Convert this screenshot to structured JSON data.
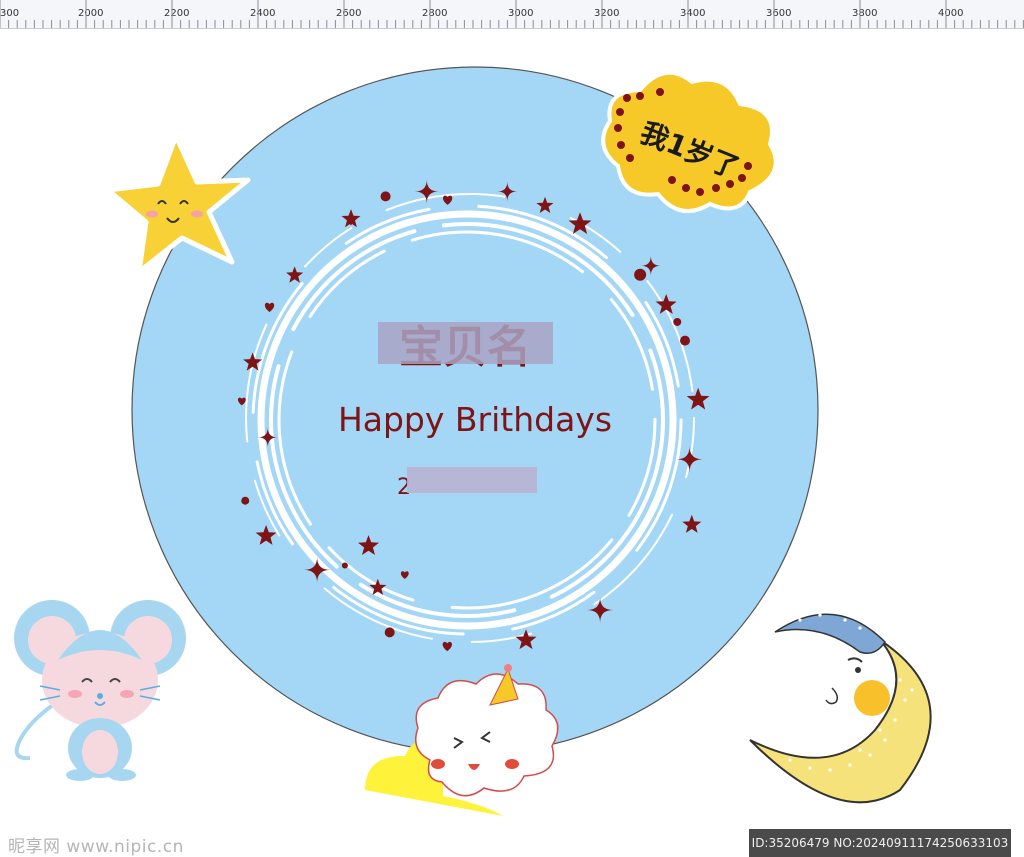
{
  "ruler": {
    "labels": [
      "300",
      "2000",
      "2200",
      "2400",
      "2600",
      "2800",
      "3000",
      "3200",
      "3400",
      "3600",
      "3800",
      "4000"
    ]
  },
  "artwork": {
    "main_name_text": "宝贝名",
    "greeting": "Happy Brithdays",
    "date_text": "2",
    "badge_text": "我1岁了",
    "colors": {
      "circle_fill": "#a4d7f5",
      "circle_stroke": "#555555",
      "accent_dark_red": "#7f1416",
      "badge_yellow": "#f7c928",
      "mouse_blue": "#a7d6f1",
      "mouse_pink": "#f6d9df",
      "moon_yellow": "#f6e27a",
      "moon_cap_blue": "#7fa7d6"
    },
    "icons": [
      "star-character-icon",
      "mouse-character-icon",
      "moon-character-icon",
      "cloud-character-icon",
      "badge-cloud-icon"
    ]
  },
  "watermark": {
    "left": "昵享网 www.nipic.cn",
    "right": "ID:35206479 NO:20240911174250633103"
  }
}
